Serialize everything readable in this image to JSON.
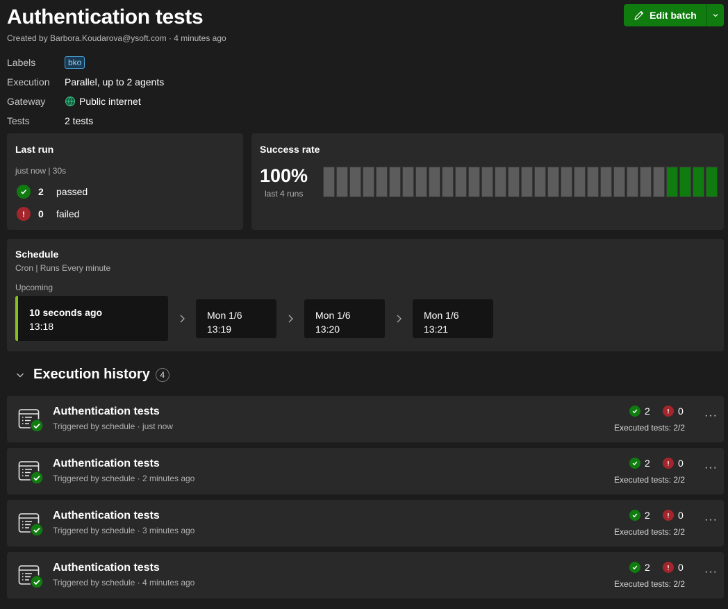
{
  "header": {
    "title": "Authentication tests",
    "subtitle": "Created by Barbora.Koudarova@ysoft.com · 4 minutes ago",
    "edit_label": "Edit batch",
    "accent": "#107c10"
  },
  "meta": {
    "labels_key": "Labels",
    "labels_value": "bko",
    "execution_key": "Execution",
    "execution_value": "Parallel, up to 2 agents",
    "gateway_key": "Gateway",
    "gateway_value": "Public internet",
    "tests_key": "Tests",
    "tests_value": "2 tests"
  },
  "last_run": {
    "title": "Last run",
    "when": "just now | 30s",
    "passed_count": "2",
    "passed_label": "passed",
    "failed_count": "0",
    "failed_label": "failed"
  },
  "success_rate": {
    "title": "Success rate",
    "value": "100%",
    "caption": "last 4 runs",
    "total_slots": 30,
    "passed_runs": 4,
    "pass_color": "#107c10",
    "empty_color": "#5c5c5c"
  },
  "schedule": {
    "title": "Schedule",
    "description": "Cron | Runs Every minute",
    "upcoming_label": "Upcoming",
    "items": [
      {
        "line1": "10 seconds ago",
        "line2": "13:18"
      },
      {
        "line1": "Mon 1/6",
        "line2": "13:19"
      },
      {
        "line1": "Mon 1/6",
        "line2": "13:20"
      },
      {
        "line1": "Mon 1/6",
        "line2": "13:21"
      }
    ]
  },
  "history": {
    "title": "Execution history",
    "count": "4",
    "runs": [
      {
        "name": "Authentication tests",
        "sub": "Triggered by schedule · just now",
        "passed": "2",
        "failed": "0",
        "executed": "Executed tests: 2/2"
      },
      {
        "name": "Authentication tests",
        "sub": "Triggered by schedule · 2 minutes ago",
        "passed": "2",
        "failed": "0",
        "executed": "Executed tests: 2/2"
      },
      {
        "name": "Authentication tests",
        "sub": "Triggered by schedule · 3 minutes ago",
        "passed": "2",
        "failed": "0",
        "executed": "Executed tests: 2/2"
      },
      {
        "name": "Authentication tests",
        "sub": "Triggered by schedule · 4 minutes ago",
        "passed": "2",
        "failed": "0",
        "executed": "Executed tests: 2/2"
      }
    ]
  }
}
